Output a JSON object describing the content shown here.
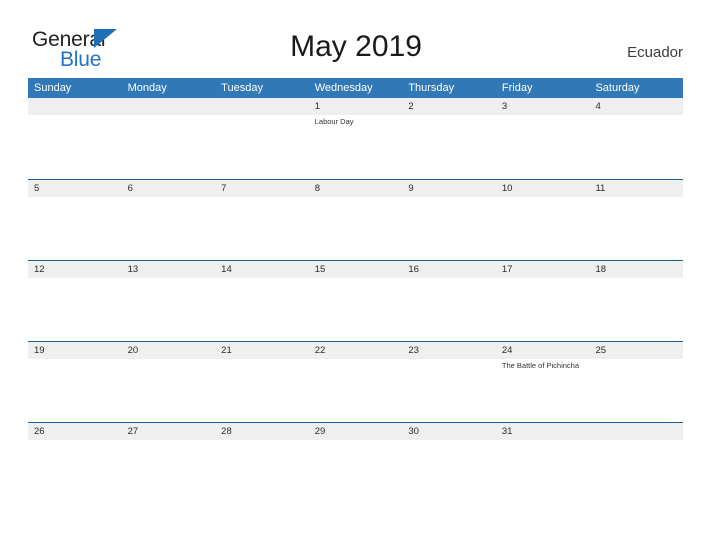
{
  "brand": {
    "word_one": "General",
    "word_two": "Blue",
    "triangle_icon": "triangle-icon"
  },
  "header": {
    "title": "May 2019",
    "region": "Ecuador"
  },
  "colors": {
    "header_blue": "#3178b7",
    "row_divider_blue": "#1f5d93",
    "date_band_gray": "#efefef",
    "brand_blue": "#2176c7",
    "brand_dark": "#231f20"
  },
  "calendar": {
    "weekdays": [
      "Sunday",
      "Monday",
      "Tuesday",
      "Wednesday",
      "Thursday",
      "Friday",
      "Saturday"
    ],
    "weeks": [
      {
        "days": [
          {
            "number": "",
            "events": []
          },
          {
            "number": "",
            "events": []
          },
          {
            "number": "",
            "events": []
          },
          {
            "number": "1",
            "events": [
              "Labour Day"
            ]
          },
          {
            "number": "2",
            "events": []
          },
          {
            "number": "3",
            "events": []
          },
          {
            "number": "4",
            "events": []
          }
        ]
      },
      {
        "days": [
          {
            "number": "5",
            "events": []
          },
          {
            "number": "6",
            "events": []
          },
          {
            "number": "7",
            "events": []
          },
          {
            "number": "8",
            "events": []
          },
          {
            "number": "9",
            "events": []
          },
          {
            "number": "10",
            "events": []
          },
          {
            "number": "11",
            "events": []
          }
        ]
      },
      {
        "days": [
          {
            "number": "12",
            "events": []
          },
          {
            "number": "13",
            "events": []
          },
          {
            "number": "14",
            "events": []
          },
          {
            "number": "15",
            "events": []
          },
          {
            "number": "16",
            "events": []
          },
          {
            "number": "17",
            "events": []
          },
          {
            "number": "18",
            "events": []
          }
        ]
      },
      {
        "days": [
          {
            "number": "19",
            "events": []
          },
          {
            "number": "20",
            "events": []
          },
          {
            "number": "21",
            "events": []
          },
          {
            "number": "22",
            "events": []
          },
          {
            "number": "23",
            "events": []
          },
          {
            "number": "24",
            "events": [
              "The Battle of Pichincha"
            ]
          },
          {
            "number": "25",
            "events": []
          }
        ]
      },
      {
        "days": [
          {
            "number": "26",
            "events": []
          },
          {
            "number": "27",
            "events": []
          },
          {
            "number": "28",
            "events": []
          },
          {
            "number": "29",
            "events": []
          },
          {
            "number": "30",
            "events": []
          },
          {
            "number": "31",
            "events": []
          },
          {
            "number": "",
            "events": []
          }
        ]
      }
    ]
  }
}
